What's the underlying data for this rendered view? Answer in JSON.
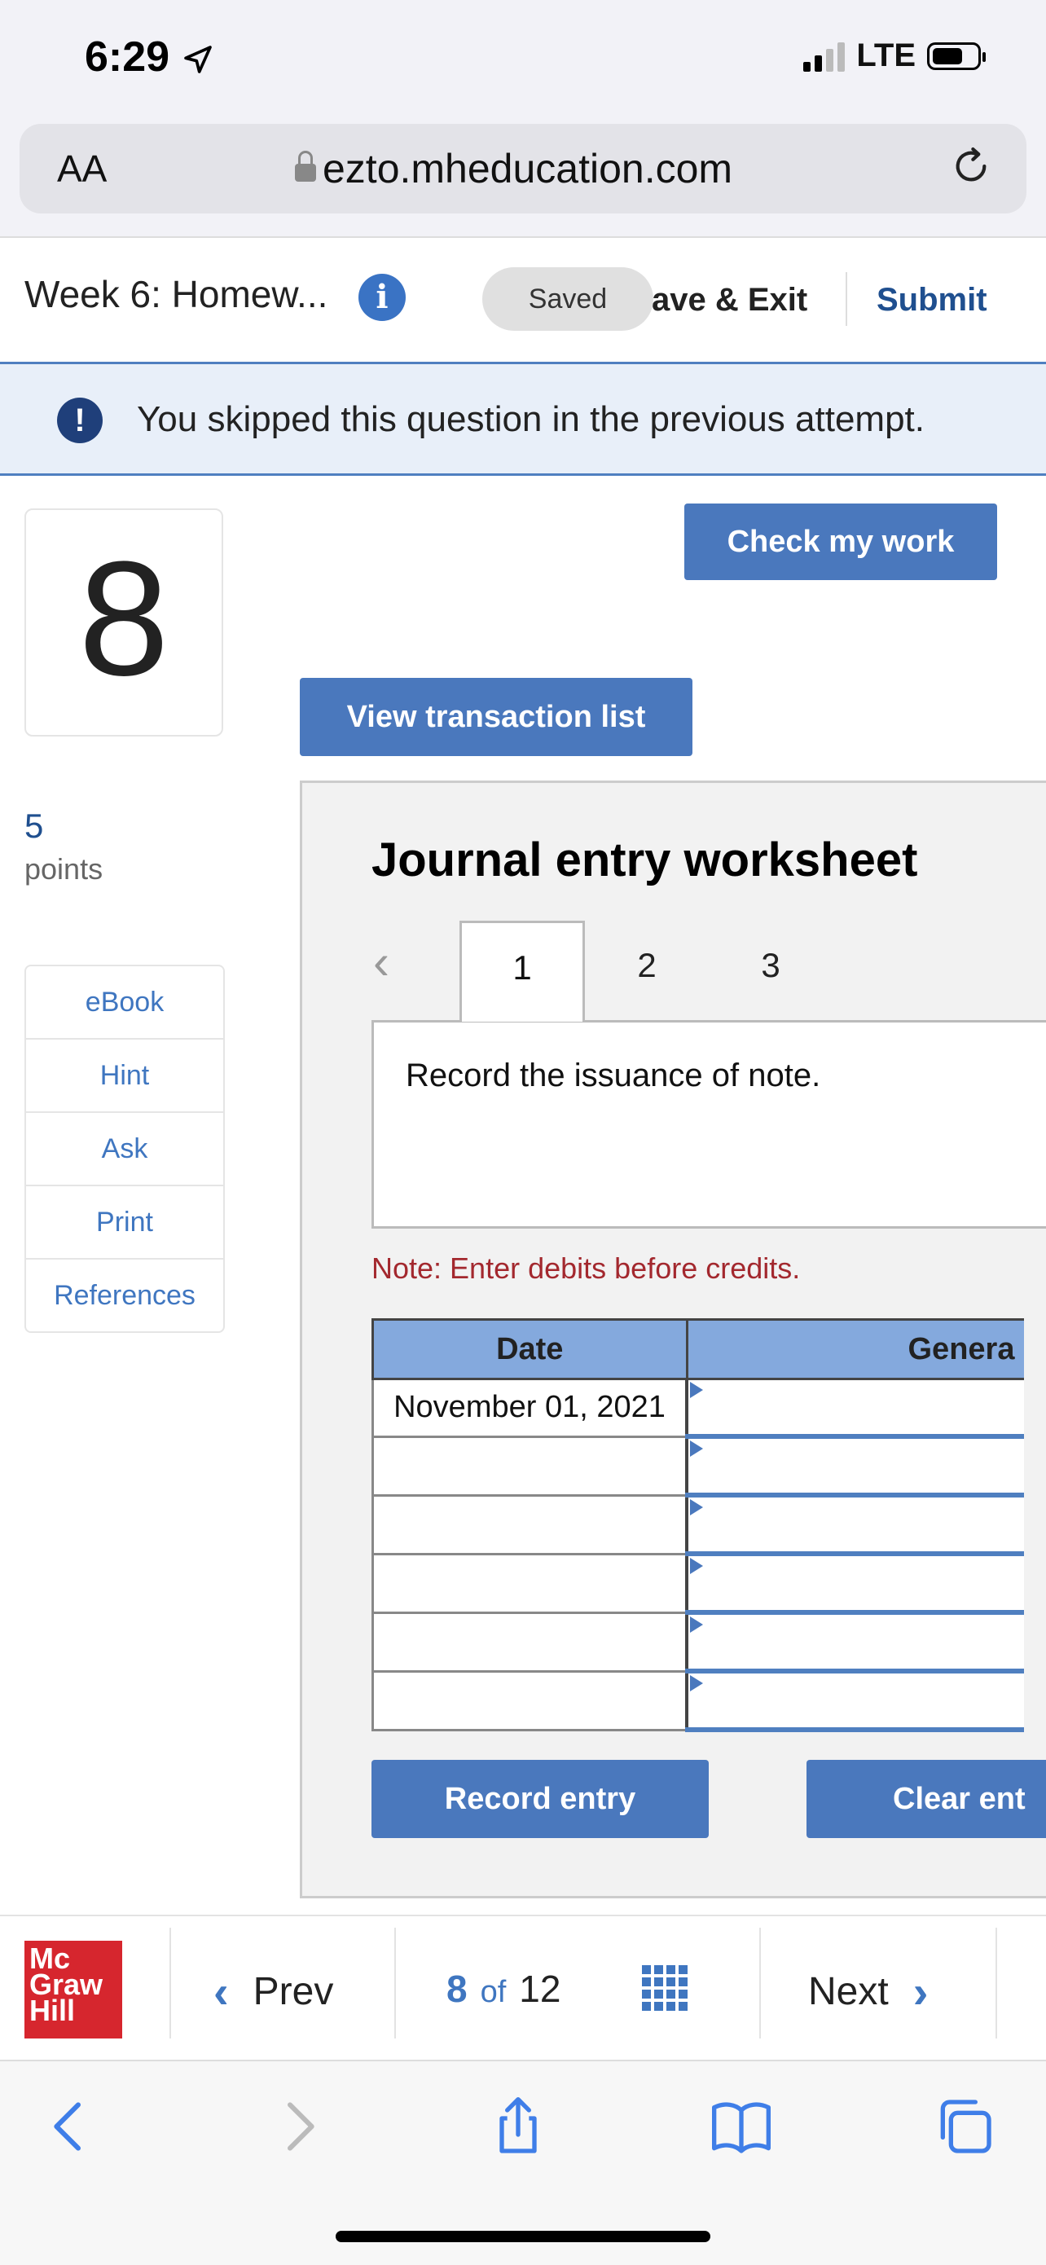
{
  "status_bar": {
    "time": "6:29",
    "network": "LTE"
  },
  "browser": {
    "text_size_label": "AA",
    "url": "ezto.mheducation.com"
  },
  "header": {
    "title": "Week 6: Homew...",
    "saved": "Saved",
    "save_exit": "ave & Exit",
    "submit": "Submit"
  },
  "banner": {
    "text": "You skipped this question in the previous attempt."
  },
  "question": {
    "number": "8",
    "points_value": "5",
    "points_label": "points"
  },
  "side_links": [
    "eBook",
    "Hint",
    "Ask",
    "Print",
    "References"
  ],
  "buttons": {
    "check_work": "Check my work",
    "view_transactions": "View transaction list",
    "record_entry": "Record entry",
    "clear_entry": "Clear ent"
  },
  "worksheet": {
    "title": "Journal entry worksheet",
    "tabs": [
      "1",
      "2",
      "3"
    ],
    "description": "Record the issuance of note.",
    "note": "Note: Enter debits before credits.",
    "columns": [
      "Date",
      "Genera"
    ],
    "rows": [
      {
        "date": "November 01, 2021",
        "account": ""
      },
      {
        "date": "",
        "account": ""
      },
      {
        "date": "",
        "account": ""
      },
      {
        "date": "",
        "account": ""
      },
      {
        "date": "",
        "account": ""
      },
      {
        "date": "",
        "account": ""
      }
    ]
  },
  "footer": {
    "logo_lines": [
      "Mc",
      "Graw",
      "Hill"
    ],
    "prev": "Prev",
    "current": "8",
    "of": "of",
    "total": "12",
    "next": "Next"
  },
  "colors": {
    "accent": "#4a78bd",
    "link": "#3f76c0",
    "note": "#a3282e",
    "brand": "#d6262e"
  }
}
